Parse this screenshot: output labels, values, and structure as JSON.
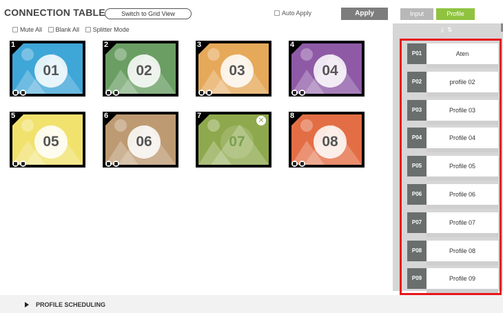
{
  "header": {
    "title": "CONNECTION TABLE",
    "switch_label": "Switch to Grid View",
    "auto_apply_label": "Auto Apply",
    "apply_label": "Apply"
  },
  "options": {
    "mute_all": "Mute All",
    "blank_all": "Blank All",
    "splitter_mode": "Splitter Mode"
  },
  "panels": [
    {
      "index": "1",
      "label": "01",
      "color": "#3fa6d8"
    },
    {
      "index": "2",
      "label": "02",
      "color": "#6a9e63"
    },
    {
      "index": "3",
      "label": "03",
      "color": "#e6a95a"
    },
    {
      "index": "4",
      "label": "04",
      "color": "#8e5aa6"
    },
    {
      "index": "5",
      "label": "05",
      "color": "#f1e26e"
    },
    {
      "index": "6",
      "label": "06",
      "color": "#bd9a72"
    },
    {
      "index": "7",
      "label": "07",
      "color": "#8ea94d"
    },
    {
      "index": "8",
      "label": "08",
      "color": "#e36e45"
    }
  ],
  "side_tabs": {
    "input": "Input",
    "profile": "Profile"
  },
  "profiles": [
    {
      "id": "P01",
      "name": "Aten"
    },
    {
      "id": "P02",
      "name": "profile 02"
    },
    {
      "id": "P03",
      "name": "Profile 03"
    },
    {
      "id": "P04",
      "name": "Profile 04"
    },
    {
      "id": "P05",
      "name": "Profile 05"
    },
    {
      "id": "P06",
      "name": "Profile 06"
    },
    {
      "id": "P07",
      "name": "Profile 07"
    },
    {
      "id": "P08",
      "name": "Profile 08"
    },
    {
      "id": "P09",
      "name": "Profile 09"
    }
  ],
  "footer": {
    "profile_scheduling": "PROFILE SCHEDULING"
  }
}
